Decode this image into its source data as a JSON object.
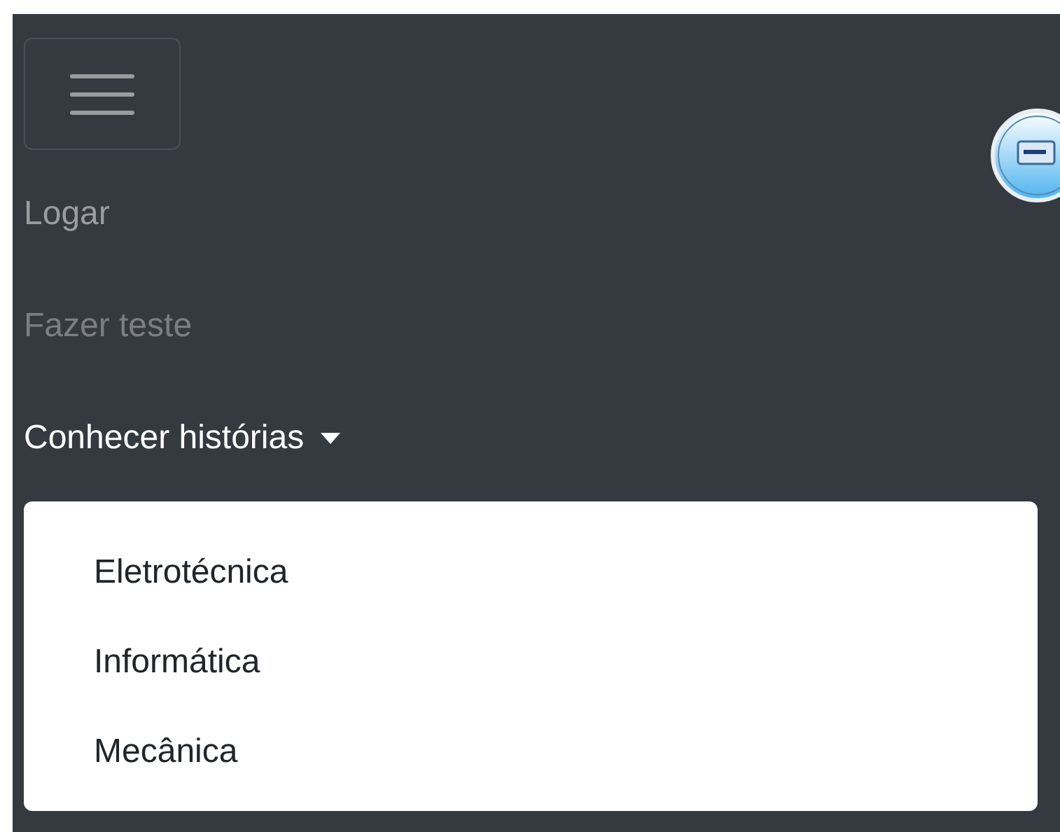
{
  "navbar": {
    "menu_button": {
      "expanded": true
    },
    "items": [
      {
        "label": "Logar",
        "active": false,
        "disabled": false
      },
      {
        "label": "Fazer teste",
        "active": false,
        "disabled": true
      },
      {
        "label": "Conhecer histórias",
        "active": true,
        "disabled": false,
        "dropdown": {
          "expanded": true,
          "items": [
            "Eletrotécnica",
            "Informática",
            "Mecânica"
          ]
        }
      }
    ]
  }
}
